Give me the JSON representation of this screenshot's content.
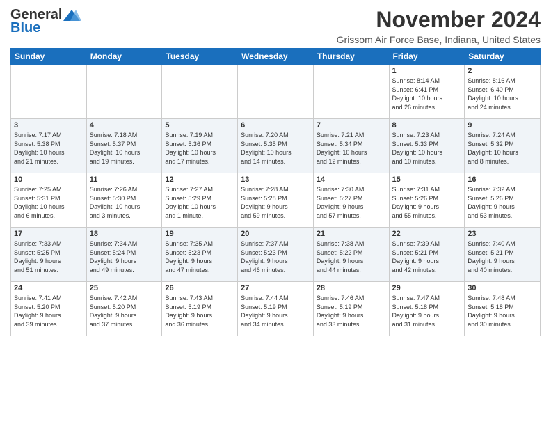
{
  "logo": {
    "line1": "General",
    "line2": "Blue"
  },
  "title": "November 2024",
  "location": "Grissom Air Force Base, Indiana, United States",
  "weekdays": [
    "Sunday",
    "Monday",
    "Tuesday",
    "Wednesday",
    "Thursday",
    "Friday",
    "Saturday"
  ],
  "weeks": [
    [
      {
        "day": "",
        "info": ""
      },
      {
        "day": "",
        "info": ""
      },
      {
        "day": "",
        "info": ""
      },
      {
        "day": "",
        "info": ""
      },
      {
        "day": "",
        "info": ""
      },
      {
        "day": "1",
        "info": "Sunrise: 8:14 AM\nSunset: 6:41 PM\nDaylight: 10 hours\nand 26 minutes."
      },
      {
        "day": "2",
        "info": "Sunrise: 8:16 AM\nSunset: 6:40 PM\nDaylight: 10 hours\nand 24 minutes."
      }
    ],
    [
      {
        "day": "3",
        "info": "Sunrise: 7:17 AM\nSunset: 5:38 PM\nDaylight: 10 hours\nand 21 minutes."
      },
      {
        "day": "4",
        "info": "Sunrise: 7:18 AM\nSunset: 5:37 PM\nDaylight: 10 hours\nand 19 minutes."
      },
      {
        "day": "5",
        "info": "Sunrise: 7:19 AM\nSunset: 5:36 PM\nDaylight: 10 hours\nand 17 minutes."
      },
      {
        "day": "6",
        "info": "Sunrise: 7:20 AM\nSunset: 5:35 PM\nDaylight: 10 hours\nand 14 minutes."
      },
      {
        "day": "7",
        "info": "Sunrise: 7:21 AM\nSunset: 5:34 PM\nDaylight: 10 hours\nand 12 minutes."
      },
      {
        "day": "8",
        "info": "Sunrise: 7:23 AM\nSunset: 5:33 PM\nDaylight: 10 hours\nand 10 minutes."
      },
      {
        "day": "9",
        "info": "Sunrise: 7:24 AM\nSunset: 5:32 PM\nDaylight: 10 hours\nand 8 minutes."
      }
    ],
    [
      {
        "day": "10",
        "info": "Sunrise: 7:25 AM\nSunset: 5:31 PM\nDaylight: 10 hours\nand 6 minutes."
      },
      {
        "day": "11",
        "info": "Sunrise: 7:26 AM\nSunset: 5:30 PM\nDaylight: 10 hours\nand 3 minutes."
      },
      {
        "day": "12",
        "info": "Sunrise: 7:27 AM\nSunset: 5:29 PM\nDaylight: 10 hours\nand 1 minute."
      },
      {
        "day": "13",
        "info": "Sunrise: 7:28 AM\nSunset: 5:28 PM\nDaylight: 9 hours\nand 59 minutes."
      },
      {
        "day": "14",
        "info": "Sunrise: 7:30 AM\nSunset: 5:27 PM\nDaylight: 9 hours\nand 57 minutes."
      },
      {
        "day": "15",
        "info": "Sunrise: 7:31 AM\nSunset: 5:26 PM\nDaylight: 9 hours\nand 55 minutes."
      },
      {
        "day": "16",
        "info": "Sunrise: 7:32 AM\nSunset: 5:26 PM\nDaylight: 9 hours\nand 53 minutes."
      }
    ],
    [
      {
        "day": "17",
        "info": "Sunrise: 7:33 AM\nSunset: 5:25 PM\nDaylight: 9 hours\nand 51 minutes."
      },
      {
        "day": "18",
        "info": "Sunrise: 7:34 AM\nSunset: 5:24 PM\nDaylight: 9 hours\nand 49 minutes."
      },
      {
        "day": "19",
        "info": "Sunrise: 7:35 AM\nSunset: 5:23 PM\nDaylight: 9 hours\nand 47 minutes."
      },
      {
        "day": "20",
        "info": "Sunrise: 7:37 AM\nSunset: 5:23 PM\nDaylight: 9 hours\nand 46 minutes."
      },
      {
        "day": "21",
        "info": "Sunrise: 7:38 AM\nSunset: 5:22 PM\nDaylight: 9 hours\nand 44 minutes."
      },
      {
        "day": "22",
        "info": "Sunrise: 7:39 AM\nSunset: 5:21 PM\nDaylight: 9 hours\nand 42 minutes."
      },
      {
        "day": "23",
        "info": "Sunrise: 7:40 AM\nSunset: 5:21 PM\nDaylight: 9 hours\nand 40 minutes."
      }
    ],
    [
      {
        "day": "24",
        "info": "Sunrise: 7:41 AM\nSunset: 5:20 PM\nDaylight: 9 hours\nand 39 minutes."
      },
      {
        "day": "25",
        "info": "Sunrise: 7:42 AM\nSunset: 5:20 PM\nDaylight: 9 hours\nand 37 minutes."
      },
      {
        "day": "26",
        "info": "Sunrise: 7:43 AM\nSunset: 5:19 PM\nDaylight: 9 hours\nand 36 minutes."
      },
      {
        "day": "27",
        "info": "Sunrise: 7:44 AM\nSunset: 5:19 PM\nDaylight: 9 hours\nand 34 minutes."
      },
      {
        "day": "28",
        "info": "Sunrise: 7:46 AM\nSunset: 5:19 PM\nDaylight: 9 hours\nand 33 minutes."
      },
      {
        "day": "29",
        "info": "Sunrise: 7:47 AM\nSunset: 5:18 PM\nDaylight: 9 hours\nand 31 minutes."
      },
      {
        "day": "30",
        "info": "Sunrise: 7:48 AM\nSunset: 5:18 PM\nDaylight: 9 hours\nand 30 minutes."
      }
    ]
  ]
}
